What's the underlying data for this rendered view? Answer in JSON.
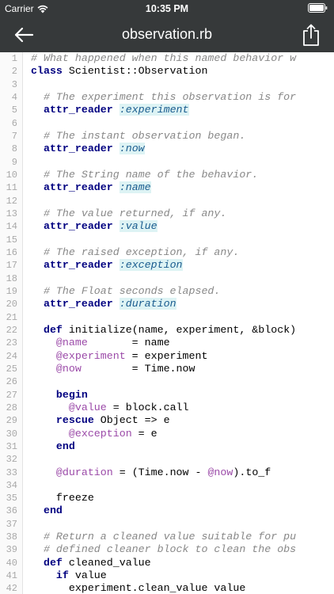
{
  "status_bar": {
    "carrier": "Carrier",
    "time": "10:35 PM"
  },
  "nav": {
    "title": "observation.rb",
    "back_icon": "back-arrow-icon",
    "share_icon": "share-icon"
  },
  "colors": {
    "bar_background": "#36393a",
    "comment": "#888888",
    "keyword": "#000080",
    "symbol": "#1a5c8f",
    "symbol_highlight": "#ddf3f4",
    "ivar": "#9b4aa8"
  },
  "code": {
    "lines": [
      {
        "n": "1",
        "tokens": [
          {
            "t": "comment",
            "v": "# What happened when this named behavior w"
          }
        ]
      },
      {
        "n": "2",
        "tokens": [
          {
            "t": "keyword",
            "v": "class"
          },
          {
            "t": "plain",
            "v": " Scientist::Observation"
          }
        ]
      },
      {
        "n": "3",
        "tokens": []
      },
      {
        "n": "4",
        "tokens": [
          {
            "t": "plain",
            "v": "  "
          },
          {
            "t": "comment",
            "v": "# The experiment this observation is for"
          }
        ]
      },
      {
        "n": "5",
        "tokens": [
          {
            "t": "plain",
            "v": "  "
          },
          {
            "t": "keyword",
            "v": "attr_reader"
          },
          {
            "t": "plain",
            "v": " "
          },
          {
            "t": "symbol",
            "v": ":experiment"
          }
        ]
      },
      {
        "n": "6",
        "tokens": []
      },
      {
        "n": "7",
        "tokens": [
          {
            "t": "plain",
            "v": "  "
          },
          {
            "t": "comment",
            "v": "# The instant observation began."
          }
        ]
      },
      {
        "n": "8",
        "tokens": [
          {
            "t": "plain",
            "v": "  "
          },
          {
            "t": "keyword",
            "v": "attr_reader"
          },
          {
            "t": "plain",
            "v": " "
          },
          {
            "t": "symbol",
            "v": ":now"
          }
        ]
      },
      {
        "n": "9",
        "tokens": []
      },
      {
        "n": "10",
        "tokens": [
          {
            "t": "plain",
            "v": "  "
          },
          {
            "t": "comment",
            "v": "# The String name of the behavior."
          }
        ]
      },
      {
        "n": "11",
        "tokens": [
          {
            "t": "plain",
            "v": "  "
          },
          {
            "t": "keyword",
            "v": "attr_reader"
          },
          {
            "t": "plain",
            "v": " "
          },
          {
            "t": "symbol",
            "v": ":name"
          }
        ]
      },
      {
        "n": "12",
        "tokens": []
      },
      {
        "n": "13",
        "tokens": [
          {
            "t": "plain",
            "v": "  "
          },
          {
            "t": "comment",
            "v": "# The value returned, if any."
          }
        ]
      },
      {
        "n": "14",
        "tokens": [
          {
            "t": "plain",
            "v": "  "
          },
          {
            "t": "keyword",
            "v": "attr_reader"
          },
          {
            "t": "plain",
            "v": " "
          },
          {
            "t": "symbol",
            "v": ":value"
          }
        ]
      },
      {
        "n": "15",
        "tokens": []
      },
      {
        "n": "16",
        "tokens": [
          {
            "t": "plain",
            "v": "  "
          },
          {
            "t": "comment",
            "v": "# The raised exception, if any."
          }
        ]
      },
      {
        "n": "17",
        "tokens": [
          {
            "t": "plain",
            "v": "  "
          },
          {
            "t": "keyword",
            "v": "attr_reader"
          },
          {
            "t": "plain",
            "v": " "
          },
          {
            "t": "symbol",
            "v": ":exception"
          }
        ]
      },
      {
        "n": "18",
        "tokens": []
      },
      {
        "n": "19",
        "tokens": [
          {
            "t": "plain",
            "v": "  "
          },
          {
            "t": "comment",
            "v": "# The Float seconds elapsed."
          }
        ]
      },
      {
        "n": "20",
        "tokens": [
          {
            "t": "plain",
            "v": "  "
          },
          {
            "t": "keyword",
            "v": "attr_reader"
          },
          {
            "t": "plain",
            "v": " "
          },
          {
            "t": "symbol",
            "v": ":duration"
          }
        ]
      },
      {
        "n": "21",
        "tokens": []
      },
      {
        "n": "22",
        "tokens": [
          {
            "t": "plain",
            "v": "  "
          },
          {
            "t": "keyword",
            "v": "def"
          },
          {
            "t": "plain",
            "v": " initialize(name, experiment, &block)"
          }
        ]
      },
      {
        "n": "23",
        "tokens": [
          {
            "t": "plain",
            "v": "    "
          },
          {
            "t": "ivar",
            "v": "@name"
          },
          {
            "t": "plain",
            "v": "       = name"
          }
        ]
      },
      {
        "n": "24",
        "tokens": [
          {
            "t": "plain",
            "v": "    "
          },
          {
            "t": "ivar",
            "v": "@experiment"
          },
          {
            "t": "plain",
            "v": " = experiment"
          }
        ]
      },
      {
        "n": "25",
        "tokens": [
          {
            "t": "plain",
            "v": "    "
          },
          {
            "t": "ivar",
            "v": "@now"
          },
          {
            "t": "plain",
            "v": "        = Time.now"
          }
        ]
      },
      {
        "n": "26",
        "tokens": []
      },
      {
        "n": "27",
        "tokens": [
          {
            "t": "plain",
            "v": "    "
          },
          {
            "t": "keyword",
            "v": "begin"
          }
        ]
      },
      {
        "n": "28",
        "tokens": [
          {
            "t": "plain",
            "v": "      "
          },
          {
            "t": "ivar",
            "v": "@value"
          },
          {
            "t": "plain",
            "v": " = block.call"
          }
        ]
      },
      {
        "n": "29",
        "tokens": [
          {
            "t": "plain",
            "v": "    "
          },
          {
            "t": "keyword",
            "v": "rescue"
          },
          {
            "t": "plain",
            "v": " Object => e"
          }
        ]
      },
      {
        "n": "30",
        "tokens": [
          {
            "t": "plain",
            "v": "      "
          },
          {
            "t": "ivar",
            "v": "@exception"
          },
          {
            "t": "plain",
            "v": " = e"
          }
        ]
      },
      {
        "n": "31",
        "tokens": [
          {
            "t": "plain",
            "v": "    "
          },
          {
            "t": "keyword",
            "v": "end"
          }
        ]
      },
      {
        "n": "32",
        "tokens": []
      },
      {
        "n": "33",
        "tokens": [
          {
            "t": "plain",
            "v": "    "
          },
          {
            "t": "ivar",
            "v": "@duration"
          },
          {
            "t": "plain",
            "v": " = (Time.now - "
          },
          {
            "t": "ivar",
            "v": "@now"
          },
          {
            "t": "plain",
            "v": ").to_f"
          }
        ]
      },
      {
        "n": "34",
        "tokens": []
      },
      {
        "n": "35",
        "tokens": [
          {
            "t": "plain",
            "v": "    freeze"
          }
        ]
      },
      {
        "n": "36",
        "tokens": [
          {
            "t": "plain",
            "v": "  "
          },
          {
            "t": "keyword",
            "v": "end"
          }
        ]
      },
      {
        "n": "37",
        "tokens": []
      },
      {
        "n": "38",
        "tokens": [
          {
            "t": "plain",
            "v": "  "
          },
          {
            "t": "comment",
            "v": "# Return a cleaned value suitable for pu"
          }
        ]
      },
      {
        "n": "39",
        "tokens": [
          {
            "t": "plain",
            "v": "  "
          },
          {
            "t": "comment",
            "v": "# defined cleaner block to clean the obs"
          }
        ]
      },
      {
        "n": "40",
        "tokens": [
          {
            "t": "plain",
            "v": "  "
          },
          {
            "t": "keyword",
            "v": "def"
          },
          {
            "t": "plain",
            "v": " cleaned_value"
          }
        ]
      },
      {
        "n": "41",
        "tokens": [
          {
            "t": "plain",
            "v": "    "
          },
          {
            "t": "keyword",
            "v": "if"
          },
          {
            "t": "plain",
            "v": " value"
          }
        ]
      },
      {
        "n": "42",
        "tokens": [
          {
            "t": "plain",
            "v": "      experiment.clean_value value"
          }
        ]
      }
    ]
  }
}
